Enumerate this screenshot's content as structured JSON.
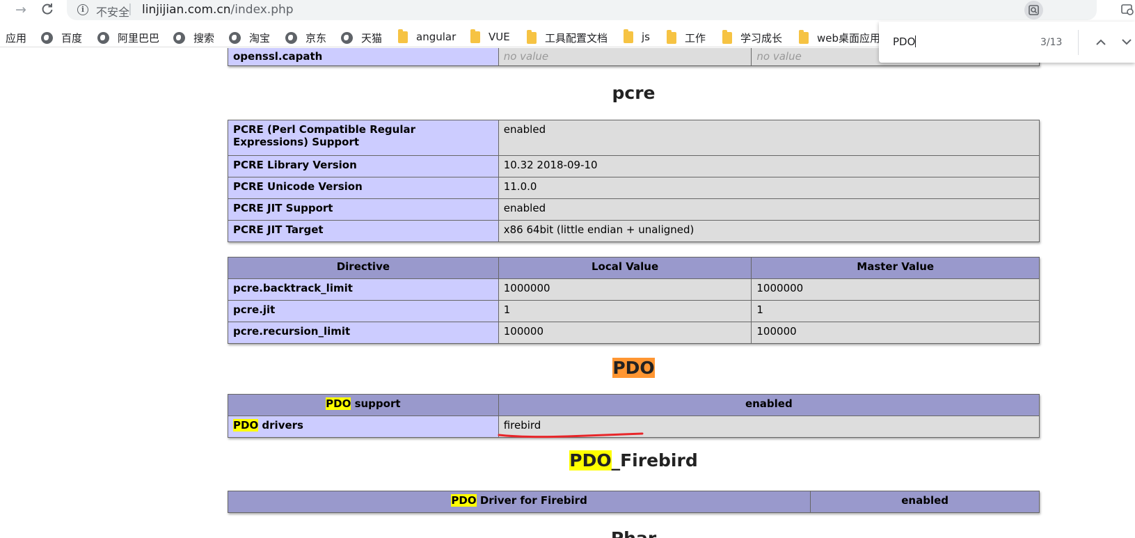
{
  "browser": {
    "insecure_label": "不安全",
    "url_host": "linjijian.com.cn",
    "url_path": "/index.php",
    "bookmarks": [
      {
        "label": "应用",
        "icon": "apps-icon"
      },
      {
        "label": "百度",
        "icon": "globe-icon"
      },
      {
        "label": "阿里巴巴",
        "icon": "globe-icon"
      },
      {
        "label": "搜索",
        "icon": "globe-icon"
      },
      {
        "label": "淘宝",
        "icon": "globe-icon"
      },
      {
        "label": "京东",
        "icon": "globe-icon"
      },
      {
        "label": "天猫",
        "icon": "globe-icon"
      },
      {
        "label": "angular",
        "icon": "folder-icon"
      },
      {
        "label": "VUE",
        "icon": "folder-icon"
      },
      {
        "label": "工具配置文档",
        "icon": "folder-icon"
      },
      {
        "label": "js",
        "icon": "folder-icon"
      },
      {
        "label": "工作",
        "icon": "folder-icon"
      },
      {
        "label": "学习成长",
        "icon": "folder-icon"
      },
      {
        "label": "web桌面应用",
        "icon": "folder-icon"
      }
    ]
  },
  "find_bar": {
    "query": "PDO",
    "count": "3/13"
  },
  "page": {
    "openssl_row": {
      "name": "openssl.capath",
      "local": "no value",
      "master": "no value"
    },
    "pcre": {
      "title": "pcre",
      "info_rows": [
        {
          "name": "PCRE (Perl Compatible Regular Expressions) Support",
          "value": "enabled"
        },
        {
          "name": "PCRE Library Version",
          "value": "10.32 2018-09-10"
        },
        {
          "name": "PCRE Unicode Version",
          "value": "11.0.0"
        },
        {
          "name": "PCRE JIT Support",
          "value": "enabled"
        },
        {
          "name": "PCRE JIT Target",
          "value": "x86 64bit (little endian + unaligned)"
        }
      ],
      "directive_header": {
        "directive": "Directive",
        "local": "Local Value",
        "master": "Master Value"
      },
      "directives": [
        {
          "name": "pcre.backtrack_limit",
          "local": "1000000",
          "master": "1000000"
        },
        {
          "name": "pcre.jit",
          "local": "1",
          "master": "1"
        },
        {
          "name": "pcre.recursion_limit",
          "local": "100000",
          "master": "100000"
        }
      ]
    },
    "pdo": {
      "title": "PDO",
      "support_header": {
        "match": "PDO",
        "rest": " support",
        "value": "enabled"
      },
      "drivers_row": {
        "match": "PDO",
        "rest": " drivers",
        "value": "firebird"
      }
    },
    "pdo_firebird": {
      "title_match": "PDO",
      "title_rest": "_Firebird",
      "header": {
        "match": "PDO",
        "rest": " Driver for Firebird",
        "value": "enabled"
      }
    },
    "phar": {
      "title": "Phar"
    }
  },
  "colors": {
    "header_bg": "#9999cc",
    "name_bg": "#ccccff",
    "value_bg": "#dddddd",
    "highlight": "#ffff00",
    "active_highlight": "#ff9632",
    "annotation": "#e8262a"
  }
}
